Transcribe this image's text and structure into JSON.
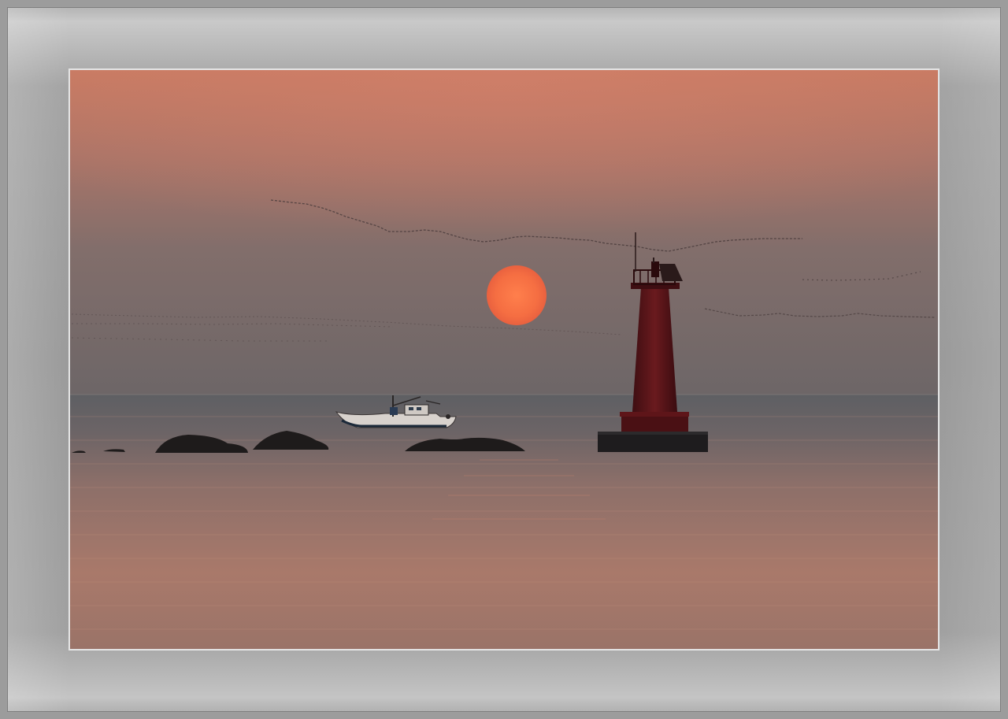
{
  "image": {
    "subject": "",
    "colors": {
      "sky_top": "#c97a62",
      "sky_mid": "#8f7068",
      "sky_bottom": "#6f6766",
      "sun_outer": "#f06a40",
      "sun_inner": "#ff7d4a",
      "sea_far": "#5f6062",
      "sea_near": "#b97a66",
      "lighthouse": "#5a1418",
      "rocks": "#1d1a1a",
      "mat": "#9d9d9d"
    }
  }
}
